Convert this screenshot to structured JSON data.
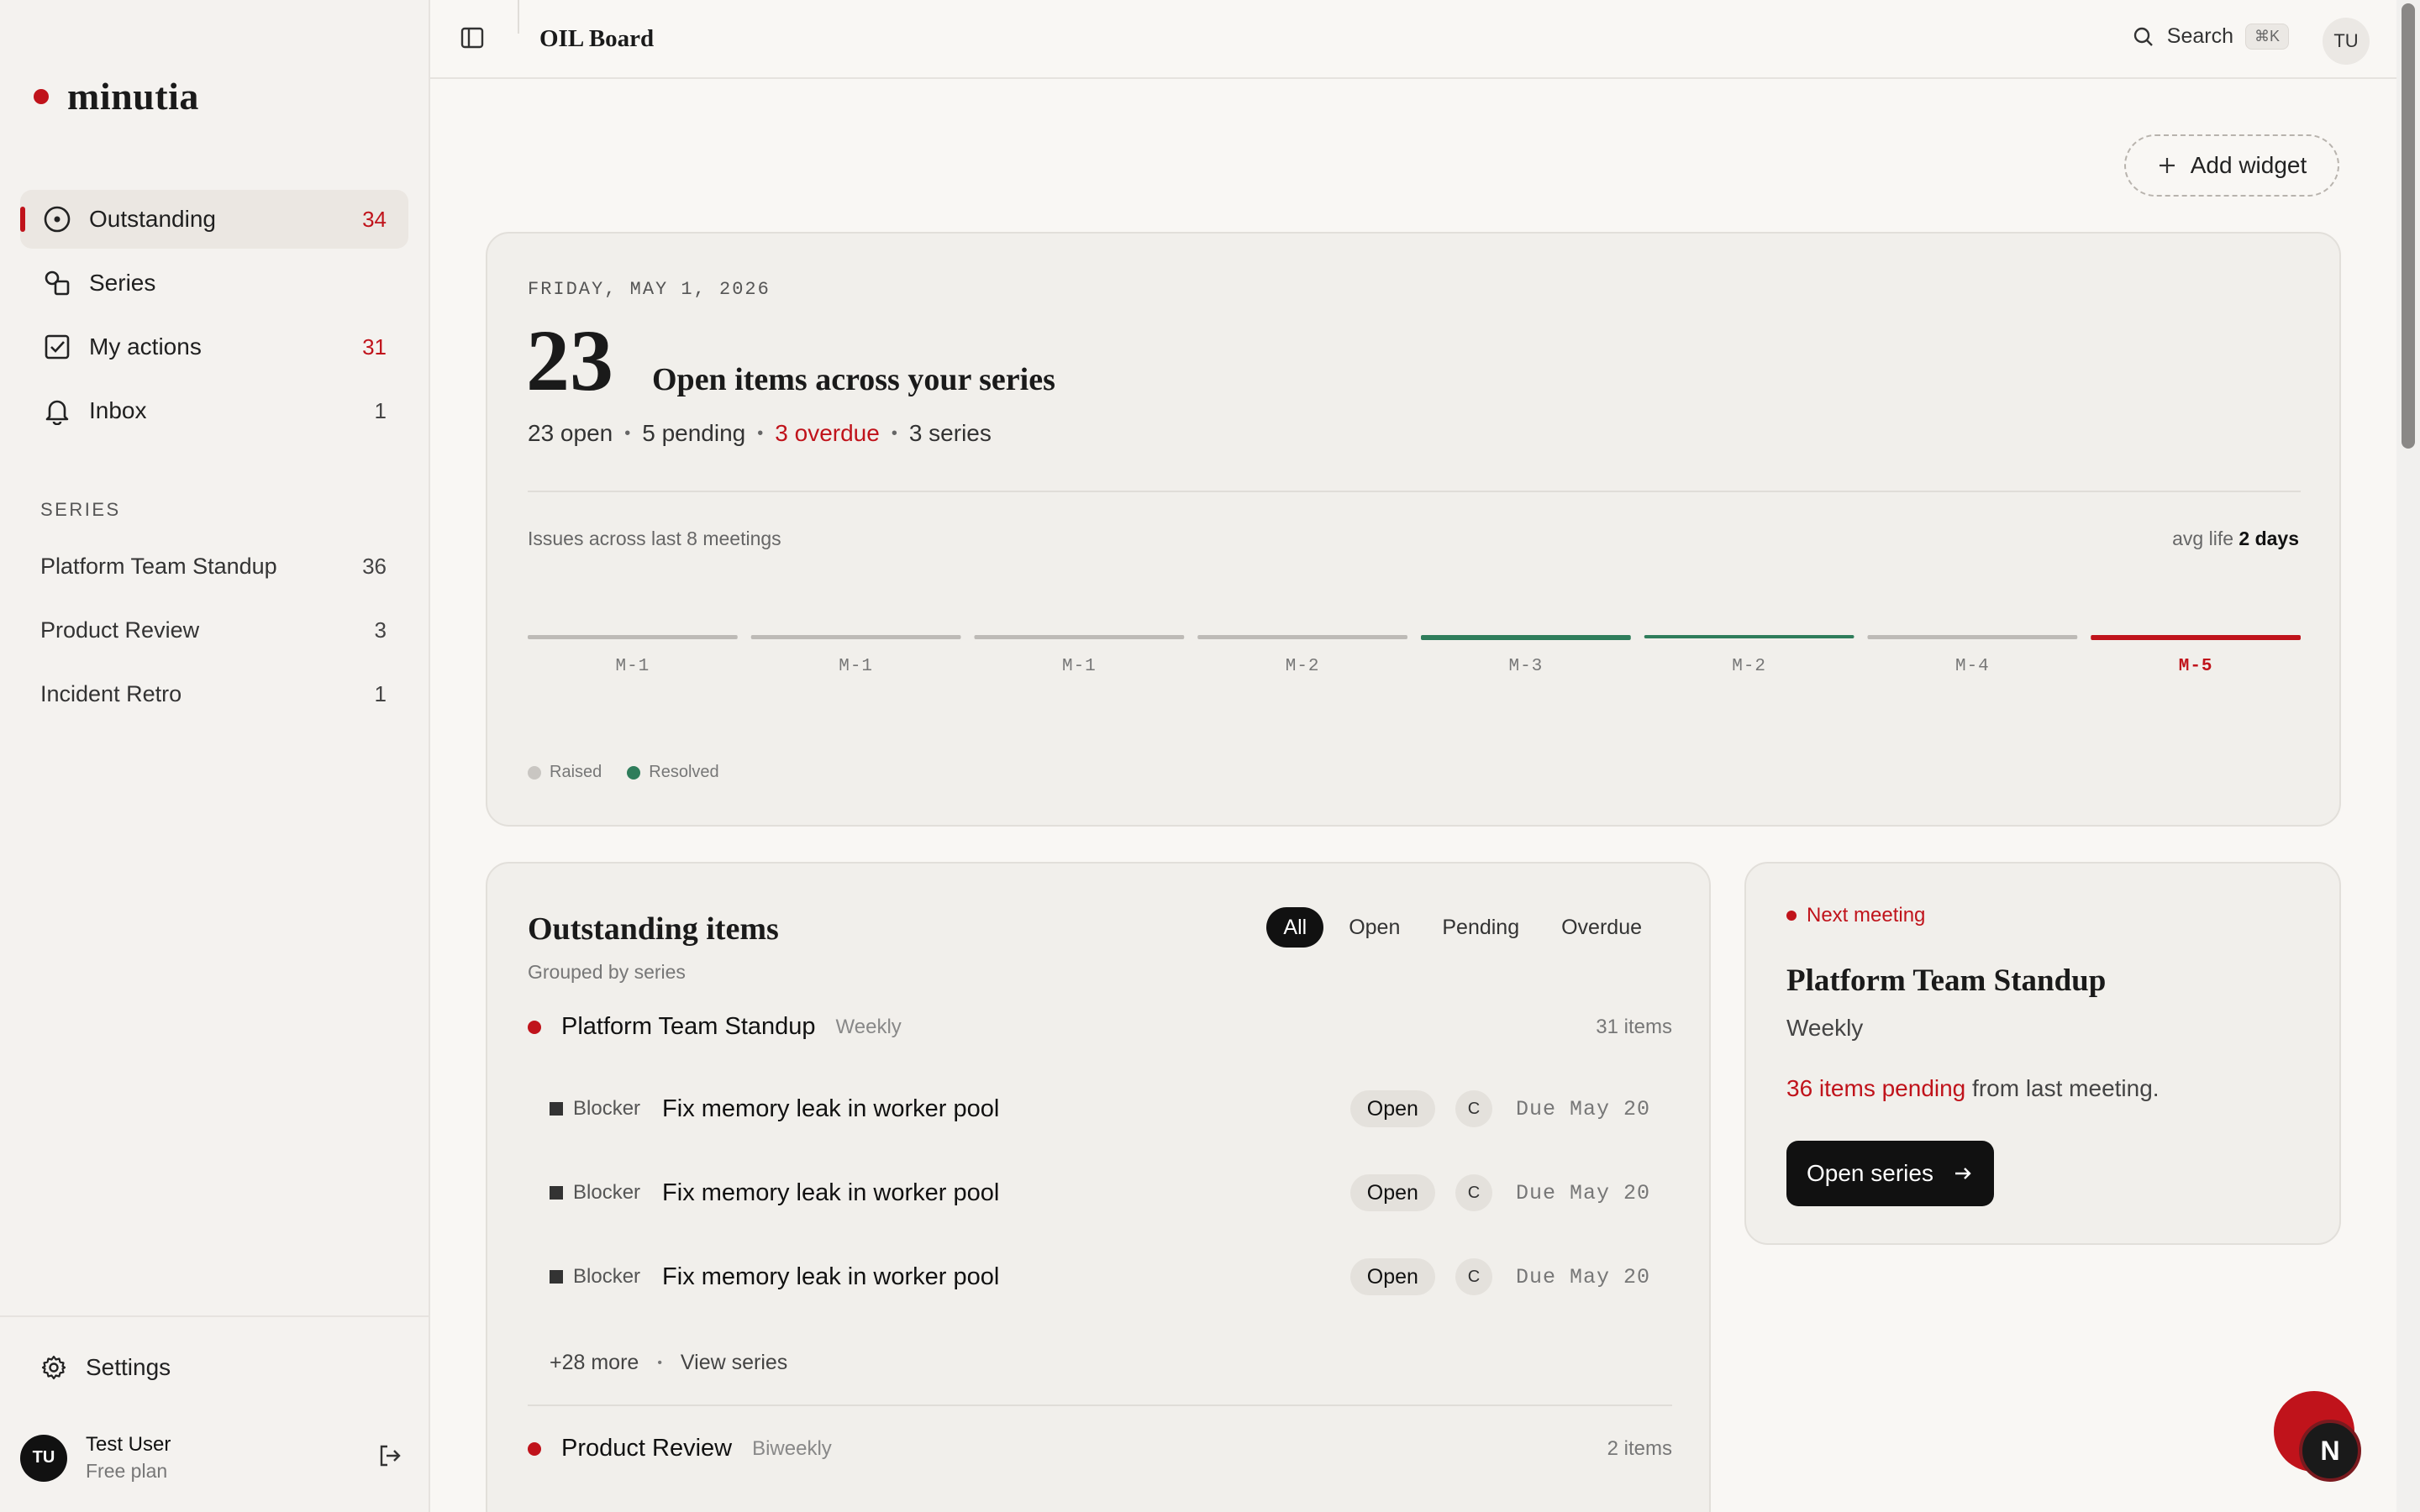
{
  "app": {
    "name": "minutia",
    "brand_color": "#c0131b"
  },
  "sidebar": {
    "nav": [
      {
        "label": "Outstanding",
        "count": "34",
        "icon": "circle-dot-icon",
        "active": true,
        "accent": true
      },
      {
        "label": "Series",
        "count": "",
        "icon": "shapes-icon"
      },
      {
        "label": "My actions",
        "count": "31",
        "icon": "check-square-icon",
        "accent": true
      },
      {
        "label": "Inbox",
        "count": "1",
        "icon": "bell-icon"
      }
    ],
    "series_heading": "SERIES",
    "series": [
      {
        "label": "Platform Team Standup",
        "count": "36"
      },
      {
        "label": "Product Review",
        "count": "3"
      },
      {
        "label": "Incident Retro",
        "count": "1"
      }
    ],
    "settings_label": "Settings",
    "user": {
      "initials": "TU",
      "name": "Test User",
      "plan": "Free plan"
    }
  },
  "topbar": {
    "title": "OIL Board",
    "search_label": "Search",
    "shortcut": "⌘K",
    "avatar": "TU"
  },
  "main": {
    "add_widget": "Add widget",
    "summary": {
      "date": "FRIDAY, MAY 1, 2026",
      "big_number": "23",
      "title": "Open items across your series",
      "stats": {
        "open": "23 open",
        "pending": "5 pending",
        "overdue": "3 overdue",
        "series": "3 series"
      },
      "chart_title": "Issues across last 8 meetings",
      "avg_life_label": "avg life",
      "avg_life_value": "2 days",
      "legend": {
        "raised": "Raised",
        "resolved": "Resolved"
      }
    },
    "outstanding": {
      "title": "Outstanding items",
      "subtitle": "Grouped by series",
      "filters": [
        "All",
        "Open",
        "Pending",
        "Overdue"
      ],
      "groups": [
        {
          "name": "Platform Team Standup",
          "frequency": "Weekly",
          "count": "31 items",
          "items": [
            {
              "tag": "Blocker",
              "title": "Fix memory leak in worker pool",
              "status": "Open",
              "assignee": "C",
              "due": "Due May 20"
            },
            {
              "tag": "Blocker",
              "title": "Fix memory leak in worker pool",
              "status": "Open",
              "assignee": "C",
              "due": "Due May 20"
            },
            {
              "tag": "Blocker",
              "title": "Fix memory leak in worker pool",
              "status": "Open",
              "assignee": "C",
              "due": "Due May 20"
            }
          ],
          "more": "+28 more",
          "view": "View series"
        },
        {
          "name": "Product Review",
          "frequency": "Biweekly",
          "count": "2 items"
        }
      ]
    },
    "next_meeting": {
      "label": "Next meeting",
      "title": "Platform Team Standup",
      "frequency": "Weekly",
      "pending_highlight": "36 items pending",
      "pending_rest": " from last meeting.",
      "button": "Open series"
    },
    "fab_badge": "N"
  },
  "chart_data": {
    "type": "bar",
    "categories": [
      "M-1",
      "M-1",
      "M-1",
      "M-2",
      "M-3",
      "M-2",
      "M-4",
      "M-5"
    ],
    "series": [
      {
        "name": "Raised",
        "values": [
          0,
          0,
          0,
          0,
          0,
          0,
          0,
          0
        ]
      },
      {
        "name": "Resolved",
        "values": [
          0,
          0,
          0,
          0,
          0,
          0,
          0,
          0
        ]
      }
    ],
    "highlight_category_index": 7,
    "colors": {
      "raised": "#bdbab6",
      "resolved": "#2f7d5b",
      "highlight": "#c0131b"
    },
    "legend": "bottom-left",
    "grid": false
  }
}
